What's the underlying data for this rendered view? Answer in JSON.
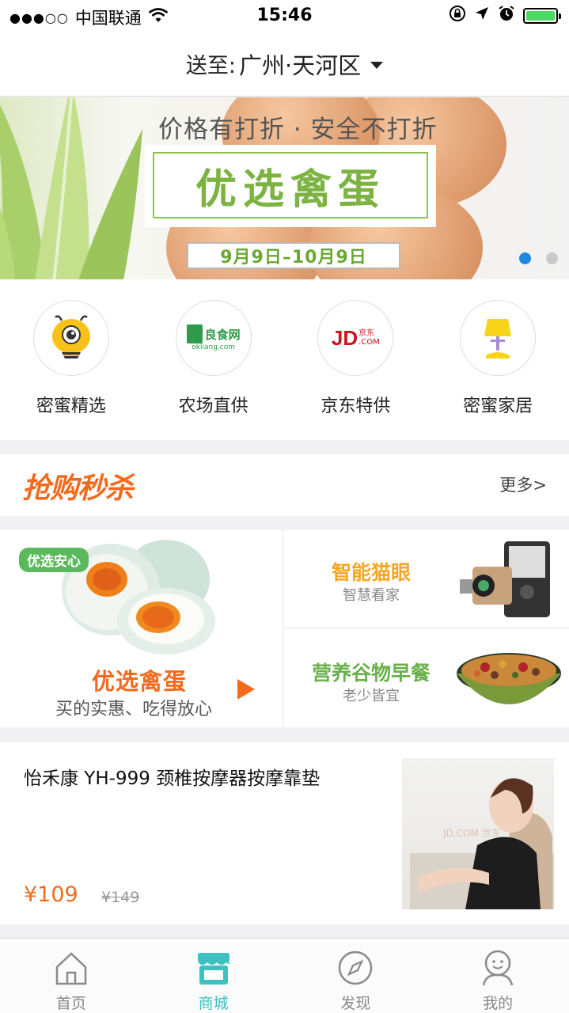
{
  "status_bar": {
    "signal": "●●●○○",
    "carrier": "中国联通",
    "time": "15:46",
    "battery_level": 1.0
  },
  "header": {
    "label": "送至:",
    "location": "广州·天河区"
  },
  "banner": {
    "tagline": "价格有打折 · 安全不打折",
    "title": "优选禽蛋",
    "date_range": "9月9日–10月9日",
    "slide_count": 2,
    "active_slide": 1
  },
  "categories": [
    {
      "label": "密蜜精选",
      "icon": "bee-mascot-icon"
    },
    {
      "label": "农场直供",
      "icon": "liangshiwang-logo-icon",
      "logo_text": "良食网",
      "logo_sub": "okliang.com"
    },
    {
      "label": "京东特供",
      "icon": "jd-logo-icon",
      "logo_text": "JD",
      "logo_cn": "京东",
      "logo_sub": ".COM"
    },
    {
      "label": "密蜜家居",
      "icon": "lamp-icon"
    }
  ],
  "flash_sale": {
    "title": "抢购秒杀",
    "more": "更多>"
  },
  "promo": {
    "left": {
      "badge": "优选安心",
      "title": "优选禽蛋",
      "subtitle": "买的实惠、吃得放心"
    },
    "right_top": {
      "title": "智能猫眼",
      "subtitle": "智慧看家",
      "title_color": "#f5a623"
    },
    "right_bottom": {
      "title": "营养谷物早餐",
      "subtitle": "老少皆宜",
      "title_color": "#6ab04c"
    }
  },
  "product": {
    "name": "怡禾康 YH-999 颈椎按摩器按摩靠垫",
    "price": "¥109",
    "original_price": "¥149",
    "image_watermark": "JD.COM 京东"
  },
  "tabbar": [
    {
      "label": "首页",
      "icon": "home-icon",
      "active": false
    },
    {
      "label": "商城",
      "icon": "store-icon",
      "active": true
    },
    {
      "label": "发现",
      "icon": "compass-icon",
      "active": false
    },
    {
      "label": "我的",
      "icon": "user-icon",
      "active": false
    }
  ],
  "colors": {
    "accent_orange": "#f26b1d",
    "accent_green": "#7cb342",
    "accent_teal": "#3cc0c0",
    "carousel_active": "#1e88e5"
  }
}
